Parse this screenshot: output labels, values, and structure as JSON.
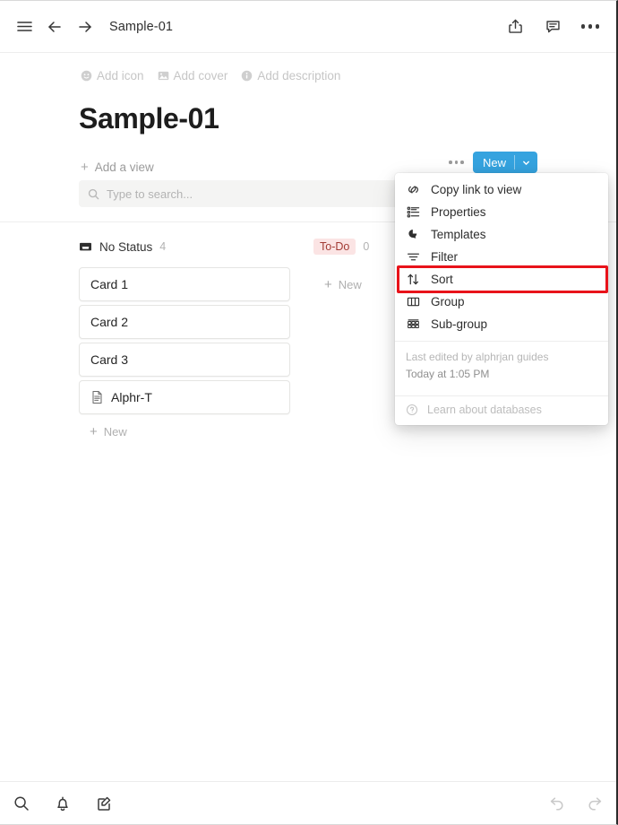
{
  "topbar": {
    "menu_icon": "hamburger-icon",
    "back_icon": "arrow-left-icon",
    "forward_icon": "arrow-right-icon",
    "title": "Sample-01",
    "share_icon": "share-icon",
    "comment_icon": "comment-icon",
    "more_icon": "more-horizontal-icon"
  },
  "meta": {
    "add_icon_label": "Add icon",
    "add_cover_label": "Add cover",
    "add_description_label": "Add description"
  },
  "page": {
    "heading": "Sample-01",
    "add_view_label": "Add a view"
  },
  "view_actions": {
    "more_icon": "more-horizontal-icon",
    "new_label": "New",
    "new_chevron": "chevron-down-icon",
    "new_color": "#35a3df"
  },
  "search": {
    "icon": "search-icon",
    "placeholder": "Type to search..."
  },
  "board": {
    "columns": [
      {
        "name": "No Status",
        "count": "4",
        "style": "plain",
        "icon": "inbox-icon",
        "cards": [
          {
            "title": "Card 1",
            "icon": null
          },
          {
            "title": "Card 2",
            "icon": null
          },
          {
            "title": "Card 3",
            "icon": null
          },
          {
            "title": "Alphr-T",
            "icon": "document-icon"
          }
        ],
        "new_label": "New"
      },
      {
        "name": "To-Do",
        "count": "0",
        "style": "pill",
        "pill_bg": "#fbe4e4",
        "pill_fg": "#a23b34",
        "cards": [],
        "new_label": "New"
      }
    ]
  },
  "menu": {
    "items": [
      {
        "label": "Copy link to view",
        "icon": "link-icon",
        "highlighted": false
      },
      {
        "label": "Properties",
        "icon": "list-properties-icon",
        "highlighted": false
      },
      {
        "label": "Templates",
        "icon": "templates-icon",
        "highlighted": false
      },
      {
        "label": "Filter",
        "icon": "filter-icon",
        "highlighted": false
      },
      {
        "label": "Sort",
        "icon": "sort-arrows-icon",
        "highlighted": true
      },
      {
        "label": "Group",
        "icon": "group-columns-icon",
        "highlighted": false
      },
      {
        "label": "Sub-group",
        "icon": "sub-group-grid-icon",
        "highlighted": false
      }
    ],
    "last_edited": "Last edited by alphrjan guides",
    "last_edited_time": "Today at 1:05 PM",
    "learn_label": "Learn about databases",
    "learn_icon": "question-circle-icon",
    "highlight_color": "#e8131a"
  },
  "bottombar": {
    "search_icon": "search-icon",
    "notifications_icon": "bell-icon",
    "compose_icon": "compose-icon",
    "undo_icon": "undo-icon",
    "redo_icon": "redo-icon"
  }
}
